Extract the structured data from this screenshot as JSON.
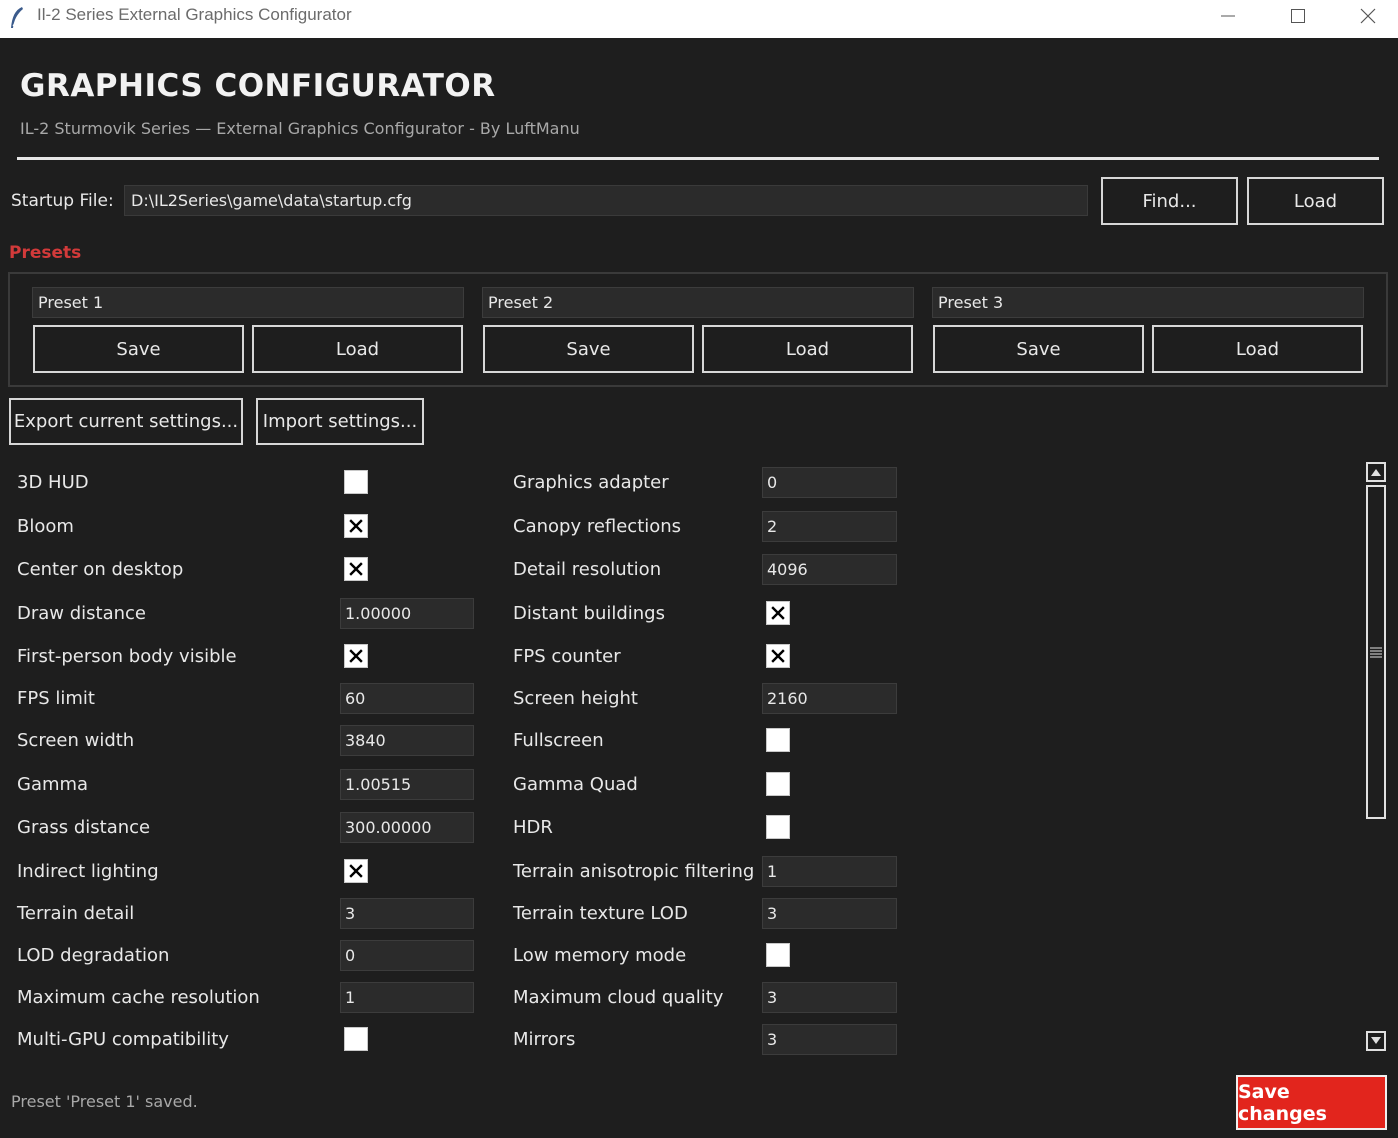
{
  "window": {
    "title": "Il-2 Series External Graphics Configurator",
    "icon": "feather-icon"
  },
  "header": {
    "title": "GRAPHICS CONFIGURATOR",
    "subtitle": "IL-2 Sturmovik Series — External Graphics Configurator - By LuftManu"
  },
  "startup": {
    "label": "Startup File:",
    "path": "D:\\IL2Series\\game\\data\\startup.cfg",
    "find_label": "Find...",
    "load_label": "Load"
  },
  "presets": {
    "label": "Presets",
    "color": "#d23a3a",
    "items": [
      {
        "name": "Preset 1",
        "save_label": "Save",
        "load_label": "Load"
      },
      {
        "name": "Preset 2",
        "save_label": "Save",
        "load_label": "Load"
      },
      {
        "name": "Preset 3",
        "save_label": "Save",
        "load_label": "Load"
      }
    ]
  },
  "actions": {
    "export_label": "Export current settings...",
    "import_label": "Import settings..."
  },
  "settings": {
    "left": [
      {
        "label": "3D HUD",
        "type": "checkbox",
        "checked": false
      },
      {
        "label": "Bloom",
        "type": "checkbox",
        "checked": true
      },
      {
        "label": "Center on desktop",
        "type": "checkbox",
        "checked": true
      },
      {
        "label": "Draw distance",
        "type": "field",
        "value": "1.00000"
      },
      {
        "label": "First-person body visible",
        "type": "checkbox",
        "checked": true
      },
      {
        "label": "FPS limit",
        "type": "field",
        "value": "60"
      },
      {
        "label": "Screen width",
        "type": "field",
        "value": "3840"
      },
      {
        "label": "Gamma",
        "type": "field",
        "value": "1.00515"
      },
      {
        "label": "Grass distance",
        "type": "field",
        "value": "300.00000"
      },
      {
        "label": "Indirect lighting",
        "type": "checkbox",
        "checked": true
      },
      {
        "label": "Terrain detail",
        "type": "field",
        "value": "3"
      },
      {
        "label": "LOD degradation",
        "type": "field",
        "value": "0"
      },
      {
        "label": "Maximum cache resolution",
        "type": "field",
        "value": "1"
      },
      {
        "label": "Multi-GPU compatibility",
        "type": "checkbox",
        "checked": false
      }
    ],
    "right": [
      {
        "label": "Graphics adapter",
        "type": "field",
        "value": "0"
      },
      {
        "label": "Canopy reflections",
        "type": "field",
        "value": "2"
      },
      {
        "label": "Detail resolution",
        "type": "field",
        "value": "4096"
      },
      {
        "label": "Distant buildings",
        "type": "checkbox",
        "checked": true
      },
      {
        "label": "FPS counter",
        "type": "checkbox",
        "checked": true
      },
      {
        "label": "Screen height",
        "type": "field",
        "value": "2160"
      },
      {
        "label": "Fullscreen",
        "type": "checkbox",
        "checked": false
      },
      {
        "label": "Gamma Quad",
        "type": "checkbox",
        "checked": false
      },
      {
        "label": "HDR",
        "type": "checkbox",
        "checked": false
      },
      {
        "label": "Terrain anisotropic filtering",
        "type": "field",
        "value": "1"
      },
      {
        "label": "Terrain texture LOD",
        "type": "field",
        "value": "3"
      },
      {
        "label": "Low memory mode",
        "type": "checkbox",
        "checked": false
      },
      {
        "label": "Maximum cloud quality",
        "type": "field",
        "value": "3"
      },
      {
        "label": "Mirrors",
        "type": "field",
        "value": "3"
      }
    ]
  },
  "footer": {
    "status": "Preset 'Preset 1' saved.",
    "save_label": "Save changes",
    "save_color": "#e2251d"
  }
}
